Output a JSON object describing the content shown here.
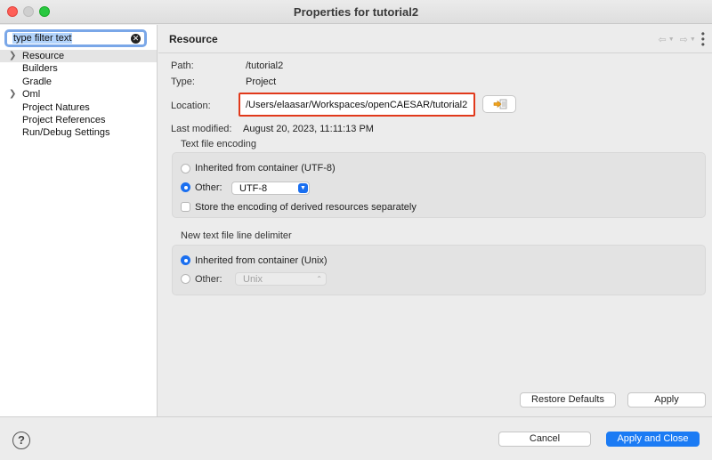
{
  "window": {
    "title": "Properties for tutorial2"
  },
  "sidebar": {
    "filter_value": "type filter text",
    "items": [
      {
        "label": "Resource",
        "expandable": true,
        "selected": true
      },
      {
        "label": "Builders",
        "expandable": false
      },
      {
        "label": "Gradle",
        "expandable": false
      },
      {
        "label": "Oml",
        "expandable": true
      },
      {
        "label": "Project Natures",
        "expandable": false
      },
      {
        "label": "Project References",
        "expandable": false
      },
      {
        "label": "Run/Debug Settings",
        "expandable": false
      }
    ]
  },
  "main": {
    "title": "Resource",
    "path_label": "Path:",
    "path_value": "/tutorial2",
    "type_label": "Type:",
    "type_value": "Project",
    "location_label": "Location:",
    "location_value": "/Users/elaasar/Workspaces/openCAESAR/tutorial2",
    "modified_label": "Last modified:",
    "modified_value": "August 20, 2023, 11:11:13 PM",
    "encoding": {
      "title": "Text file encoding",
      "inherited_label": "Inherited from container (UTF-8)",
      "other_label": "Other:",
      "other_value": "UTF-8",
      "store_label": "Store the encoding of derived resources separately",
      "selected": "other"
    },
    "delimiter": {
      "title": "New text file line delimiter",
      "inherited_label": "Inherited from container (Unix)",
      "other_label": "Other:",
      "other_value": "Unix",
      "selected": "inherited"
    },
    "restore_defaults_label": "Restore Defaults",
    "apply_label": "Apply"
  },
  "footer": {
    "help_icon": "?",
    "cancel_label": "Cancel",
    "apply_close_label": "Apply and Close"
  },
  "colors": {
    "accent": "#1b7bf4",
    "highlight_border": "#e1391b"
  }
}
